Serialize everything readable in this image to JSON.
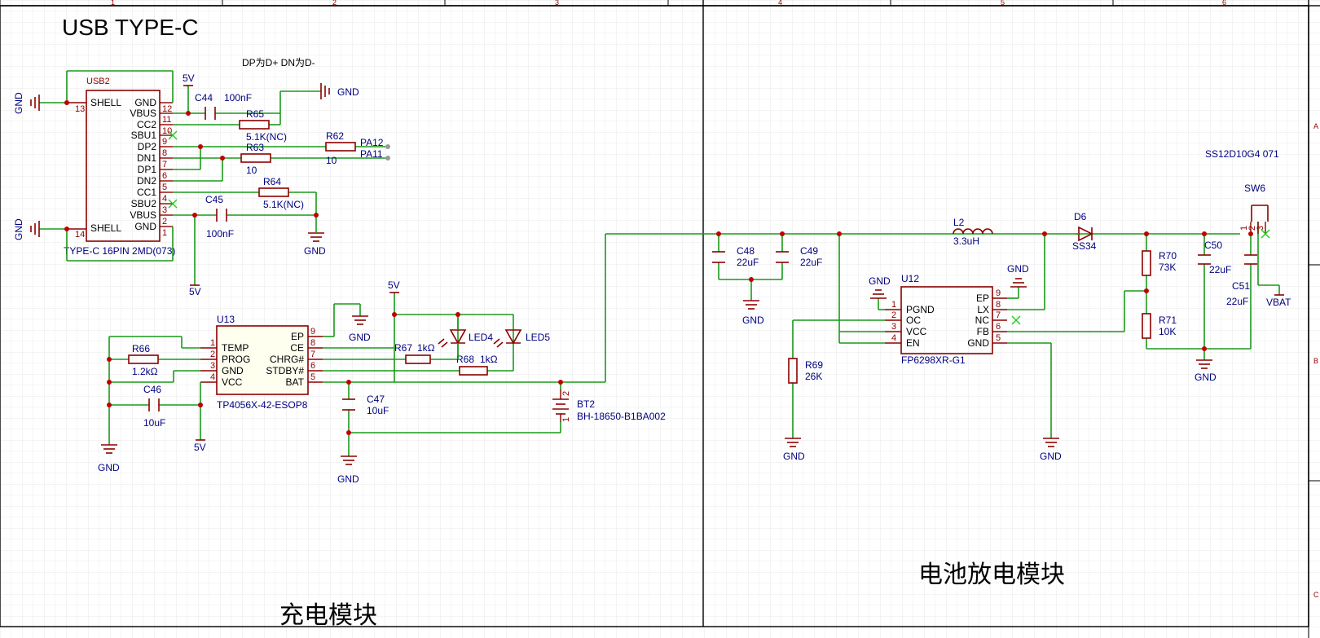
{
  "labels": {
    "title": "USB TYPE-C",
    "dp_note": "DP为D+ DN为D-",
    "charging_section": "充电模块",
    "discharge_section": "电池放电模块",
    "sw_part": "SS12D10G4 071",
    "frame_cols": [
      "1",
      "2",
      "3",
      "4",
      "5",
      "6"
    ],
    "frame_rows": [
      "A",
      "B",
      "C"
    ]
  },
  "usb": {
    "ref": "USB2",
    "value": "TYPE-C 16PIN 2MD(073)",
    "left_pins": [
      "SHELL",
      "SHELL"
    ],
    "left_nums": [
      "13",
      "14"
    ],
    "right_pins": [
      "GND",
      "VBUS",
      "CC2",
      "SBU1",
      "DP2",
      "DN1",
      "DP1",
      "DN2",
      "CC1",
      "SBU2",
      "VBUS",
      "GND"
    ],
    "right_nums": [
      "12",
      "11",
      "10",
      "9",
      "8",
      "7",
      "6",
      "5",
      "4",
      "3",
      "2",
      "1"
    ]
  },
  "u13": {
    "ref": "U13",
    "value": "TP4056X-42-ESOP8",
    "left_pins": [
      "TEMP",
      "PROG",
      "GND",
      "VCC"
    ],
    "left_nums": [
      "1",
      "2",
      "3",
      "4"
    ],
    "right_pins": [
      "EP",
      "CE",
      "CHRG#",
      "STDBY#",
      "BAT"
    ],
    "right_nums": [
      "9",
      "8",
      "7",
      "6",
      "5"
    ]
  },
  "u12": {
    "ref": "U12",
    "value": "FP6298XR-G1",
    "left_pins": [
      "PGND",
      "OC",
      "VCC",
      "EN"
    ],
    "left_nums": [
      "1",
      "2",
      "3",
      "4"
    ],
    "right_pins": [
      "EP",
      "LX",
      "NC",
      "FB",
      "GND"
    ],
    "right_nums": [
      "9",
      "8",
      "7",
      "6",
      "5"
    ]
  },
  "components": {
    "c44": {
      "ref": "C44",
      "value": "100nF"
    },
    "c45": {
      "ref": "C45",
      "value": "100nF"
    },
    "r65": {
      "ref": "R65",
      "value": "5.1K(NC)"
    },
    "r64": {
      "ref": "R64",
      "value": "5.1K(NC)"
    },
    "r62": {
      "ref": "R62",
      "value": "10"
    },
    "r63": {
      "ref": "R63",
      "value": "10"
    },
    "r66": {
      "ref": "R66",
      "value": "1.2kΩ"
    },
    "c46": {
      "ref": "C46",
      "value": "10uF"
    },
    "c47": {
      "ref": "C47",
      "value": "10uF"
    },
    "r67": {
      "ref": "R67",
      "value": "1kΩ"
    },
    "r68": {
      "ref": "R68",
      "value": "1kΩ"
    },
    "led4": {
      "ref": "LED4"
    },
    "led5": {
      "ref": "LED5"
    },
    "bt2": {
      "ref": "BT2",
      "value": "BH-18650-B1BA002",
      "pin_a": "2",
      "pin_b": "1"
    },
    "c48": {
      "ref": "C48",
      "value": "22uF"
    },
    "c49": {
      "ref": "C49",
      "value": "22uF"
    },
    "l2": {
      "ref": "L2",
      "value": "3.3uH"
    },
    "d6": {
      "ref": "D6",
      "value": "SS34"
    },
    "r70": {
      "ref": "R70",
      "value": "73K"
    },
    "r71": {
      "ref": "R71",
      "value": "10K"
    },
    "r69": {
      "ref": "R69",
      "value": "26K"
    },
    "c50": {
      "ref": "C50",
      "value": "22uF"
    },
    "c51": {
      "ref": "C51",
      "value": "22uF"
    },
    "sw6": {
      "ref": "SW6",
      "pins": [
        "1",
        "2",
        "3"
      ]
    }
  },
  "nets": {
    "gnd": "GND",
    "v5": "5V",
    "vbat": "VBAT",
    "pa12": "PA12",
    "pa11": "PA11"
  },
  "colors": {
    "wire": "#1a9a1a",
    "pin": "#8b0000",
    "junction": "#c00000",
    "text": "#000080",
    "no_connect": "#22cc22",
    "stdby_pin": "#ff0000"
  }
}
